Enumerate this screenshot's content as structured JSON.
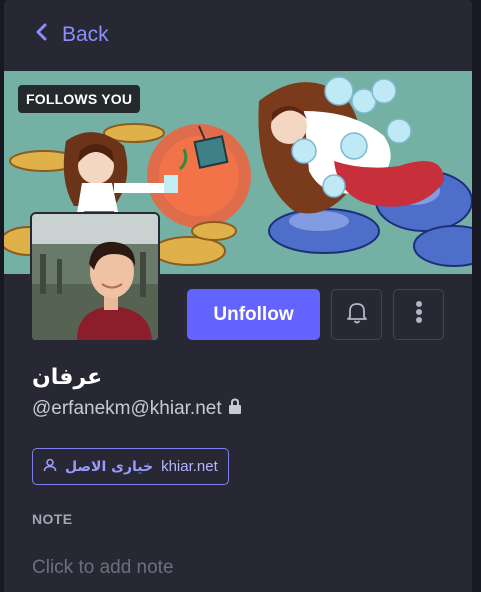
{
  "nav": {
    "back_label": "Back"
  },
  "banner": {
    "follows_badge": "FOLLOWS YOU"
  },
  "actions": {
    "unfollow_label": "Unfollow"
  },
  "profile": {
    "display_name": "عرفان",
    "handle": "@erfanekm@khiar.net",
    "locked": true
  },
  "server": {
    "name": "خیاری الاصل",
    "domain": "khiar.net"
  },
  "note": {
    "label": "NOTE",
    "placeholder": "Click to add note"
  },
  "colors": {
    "accent": "#6364ff",
    "panel": "#282834",
    "background": "#181822",
    "link": "#8c8dff",
    "banner_sky": "#74b1a4"
  },
  "icons": {
    "back": "chevron-left-icon",
    "bell": "bell-icon",
    "more": "ellipsis-vertical-icon",
    "lock": "lock-icon",
    "server": "user-icon"
  }
}
